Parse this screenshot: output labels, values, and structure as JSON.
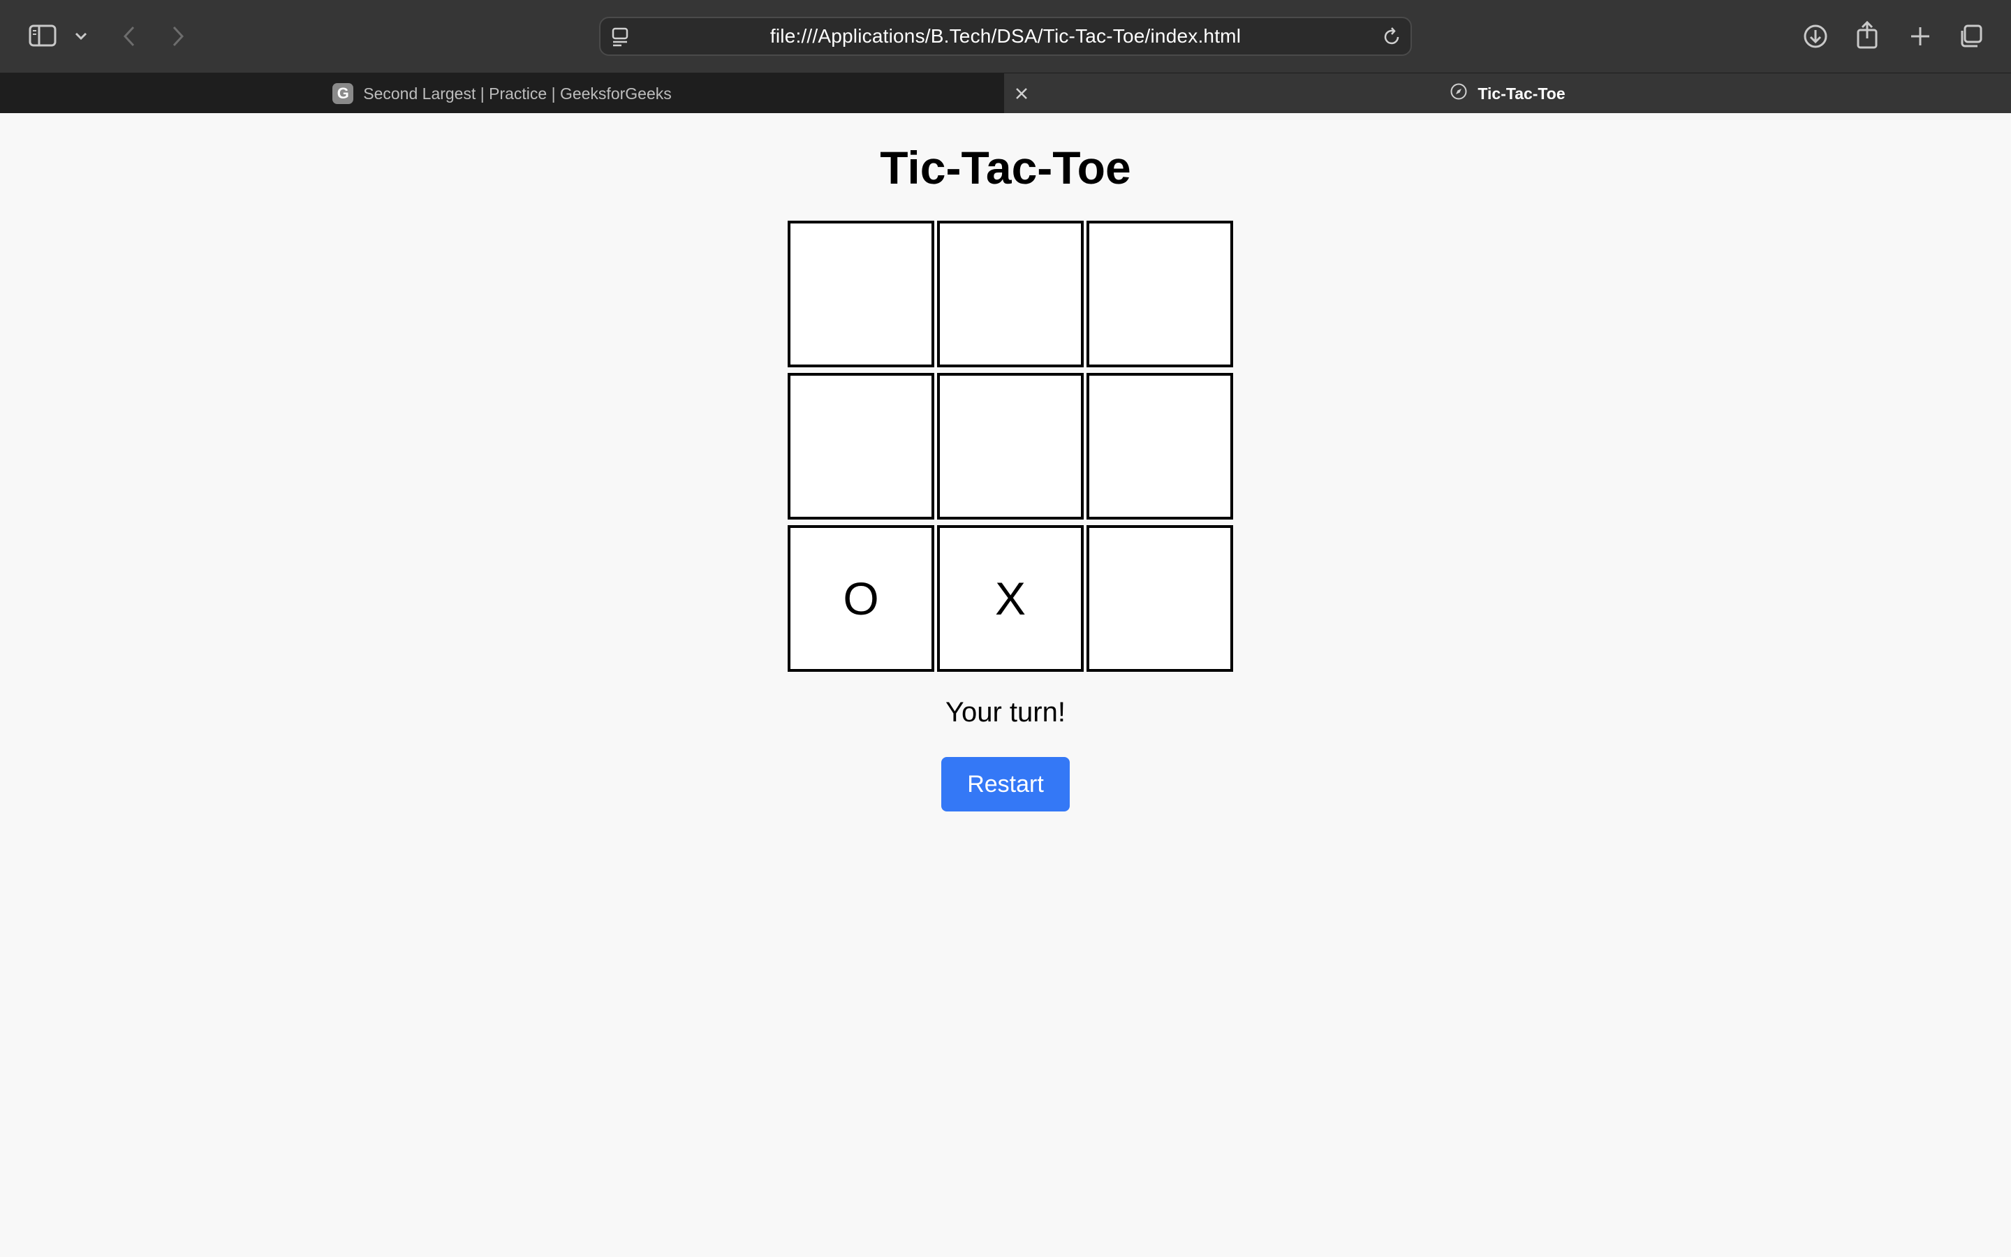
{
  "browser": {
    "url": "file:///Applications/B.Tech/DSA/Tic-Tac-Toe/index.html",
    "tabs": [
      {
        "title": "Second Largest | Practice | GeeksforGeeks",
        "favicon_letter": "G",
        "active": false
      },
      {
        "title": "Tic-Tac-Toe",
        "active": true
      }
    ]
  },
  "game": {
    "title": "Tic-Tac-Toe",
    "board": [
      "",
      "",
      "",
      "",
      "",
      "",
      "O",
      "X",
      ""
    ],
    "status": "Your turn!",
    "restart_label": "Restart"
  },
  "colors": {
    "accent": "#3478f6",
    "chrome": "#363636"
  }
}
